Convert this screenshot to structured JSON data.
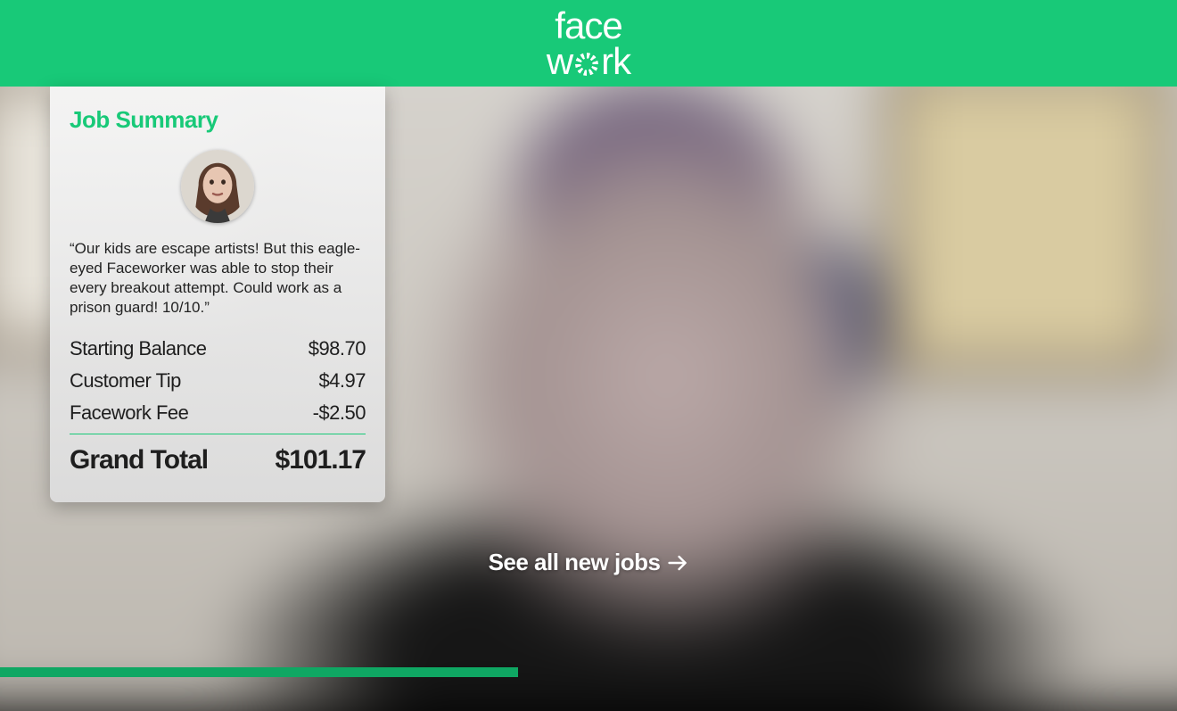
{
  "brand": {
    "line1": "face",
    "line2_pre": "w",
    "line2_post": "rk"
  },
  "card": {
    "title": "Job Summary",
    "quote": "“Our kids are escape artists! But this eagle-eyed Faceworker was able to stop their every breakout attempt. Could work as a prison guard! 10/10.”",
    "rows": [
      {
        "label": "Starting Balance",
        "value": "$98.70"
      },
      {
        "label": "Customer Tip",
        "value": "$4.97"
      },
      {
        "label": "Facework Fee",
        "value": "-$2.50"
      }
    ],
    "grand_label": "Grand Total",
    "grand_value": "$101.17"
  },
  "cta": {
    "see_all": "See all new jobs"
  },
  "progress": {
    "percent": 44
  },
  "colors": {
    "accent": "#18c978"
  }
}
